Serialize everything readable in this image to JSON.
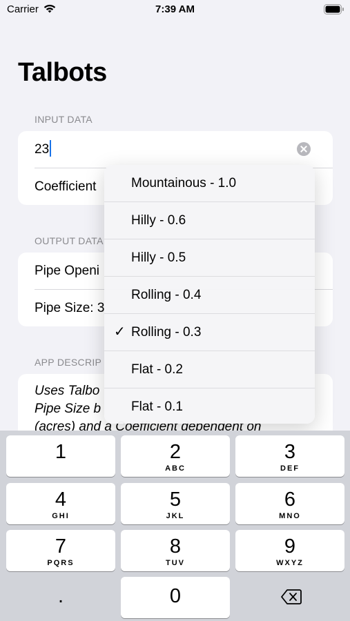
{
  "status_bar": {
    "carrier": "Carrier",
    "time": "7:39 AM"
  },
  "title": "Talbots",
  "input_section": {
    "header": "INPUT DATA",
    "area_value": "23",
    "coefficient_label": "Coefficient"
  },
  "output_section": {
    "header": "OUTPUT DATA",
    "pipe_opening_label": "Pipe Openi",
    "pipe_size_label": "Pipe Size: 3"
  },
  "description_section": {
    "header": "APP DESCRIP",
    "line1": "Uses Talbo",
    "line2": "Pipe Size b",
    "line3": "(acres) and a Coefficient dependent on"
  },
  "menu": {
    "items": [
      {
        "label": "Mountainous - 1.0",
        "checked": false
      },
      {
        "label": "Hilly - 0.6",
        "checked": false
      },
      {
        "label": "Hilly - 0.5",
        "checked": false
      },
      {
        "label": "Rolling - 0.4",
        "checked": false
      },
      {
        "label": "Rolling - 0.3",
        "checked": true
      },
      {
        "label": "Flat - 0.2",
        "checked": false
      },
      {
        "label": "Flat - 0.1",
        "checked": false
      }
    ],
    "check_glyph": "✓"
  },
  "keyboard": {
    "keys": [
      {
        "num": "1",
        "letters": ""
      },
      {
        "num": "2",
        "letters": "ABC"
      },
      {
        "num": "3",
        "letters": "DEF"
      },
      {
        "num": "4",
        "letters": "GHI"
      },
      {
        "num": "5",
        "letters": "JKL"
      },
      {
        "num": "6",
        "letters": "MNO"
      },
      {
        "num": "7",
        "letters": "PQRS"
      },
      {
        "num": "8",
        "letters": "TUV"
      },
      {
        "num": "9",
        "letters": "WXYZ"
      },
      {
        "num": "0",
        "letters": ""
      }
    ],
    "decimal": ".",
    "delete_icon": "delete-backward-icon"
  }
}
